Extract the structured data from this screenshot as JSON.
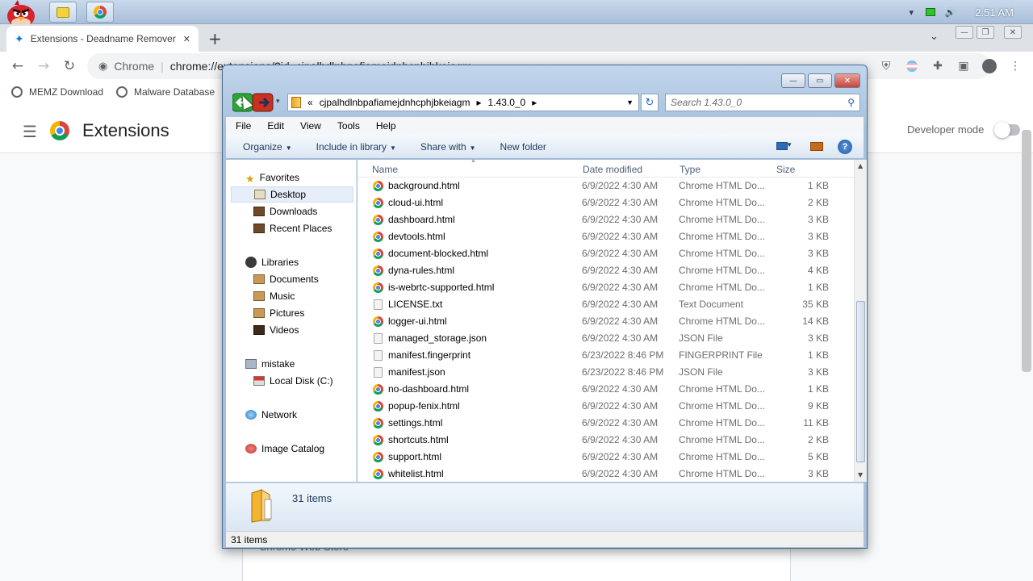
{
  "taskbar": {
    "time": "2:51 AM",
    "tray_caret": "▾",
    "icons": [
      "angry-bird-icon",
      "folder-window-icon",
      "chrome-icon",
      "battery-icon",
      "speaker-icon"
    ]
  },
  "tab": {
    "title": "Extensions - Deadname Remover",
    "close": "✕",
    "new_tab": "+"
  },
  "omnibox": {
    "site": "Chrome",
    "url": "chrome://extensions/?id=cjpalhdlnbpafiamejdnhcphjbkeiagm"
  },
  "bookmarks": [
    {
      "label": "MEMZ Download"
    },
    {
      "label": "Malware Database"
    }
  ],
  "extensions_page": {
    "title": "Extensions",
    "developer_mode": "Developer mode",
    "developer_mode_on": false,
    "webstore": "Chrome Web Store"
  },
  "explorer": {
    "breadcrumb": {
      "prefix": "«",
      "folder": "cjpalhdlnbpafiamejdnhcphjbkeiagm",
      "subfolder": "1.43.0_0",
      "sep": "▸"
    },
    "search_placeholder": "Search 1.43.0_0",
    "menu": [
      "File",
      "Edit",
      "View",
      "Tools",
      "Help"
    ],
    "commands": {
      "organize": "Organize",
      "include": "Include in library",
      "share": "Share with",
      "new_folder": "New folder"
    },
    "nav": {
      "favorites": "Favorites",
      "desktop": "Desktop",
      "downloads": "Downloads",
      "recent": "Recent Places",
      "libraries": "Libraries",
      "documents": "Documents",
      "music": "Music",
      "pictures": "Pictures",
      "videos": "Videos",
      "user": "mistake",
      "local_disk": "Local Disk (C:)",
      "network": "Network",
      "image_catalog": "Image Catalog"
    },
    "columns": {
      "name": "Name",
      "date": "Date modified",
      "type": "Type",
      "size": "Size"
    },
    "files": [
      {
        "name": "background.html",
        "date": "6/9/2022 4:30 AM",
        "type": "Chrome HTML Do...",
        "size": "1 KB",
        "icon": "chrome"
      },
      {
        "name": "cloud-ui.html",
        "date": "6/9/2022 4:30 AM",
        "type": "Chrome HTML Do...",
        "size": "2 KB",
        "icon": "chrome"
      },
      {
        "name": "dashboard.html",
        "date": "6/9/2022 4:30 AM",
        "type": "Chrome HTML Do...",
        "size": "3 KB",
        "icon": "chrome"
      },
      {
        "name": "devtools.html",
        "date": "6/9/2022 4:30 AM",
        "type": "Chrome HTML Do...",
        "size": "3 KB",
        "icon": "chrome"
      },
      {
        "name": "document-blocked.html",
        "date": "6/9/2022 4:30 AM",
        "type": "Chrome HTML Do...",
        "size": "3 KB",
        "icon": "chrome"
      },
      {
        "name": "dyna-rules.html",
        "date": "6/9/2022 4:30 AM",
        "type": "Chrome HTML Do...",
        "size": "4 KB",
        "icon": "chrome"
      },
      {
        "name": "is-webrtc-supported.html",
        "date": "6/9/2022 4:30 AM",
        "type": "Chrome HTML Do...",
        "size": "1 KB",
        "icon": "chrome"
      },
      {
        "name": "LICENSE.txt",
        "date": "6/9/2022 4:30 AM",
        "type": "Text Document",
        "size": "35 KB",
        "icon": "doc"
      },
      {
        "name": "logger-ui.html",
        "date": "6/9/2022 4:30 AM",
        "type": "Chrome HTML Do...",
        "size": "14 KB",
        "icon": "chrome"
      },
      {
        "name": "managed_storage.json",
        "date": "6/9/2022 4:30 AM",
        "type": "JSON File",
        "size": "3 KB",
        "icon": "doc"
      },
      {
        "name": "manifest.fingerprint",
        "date": "6/23/2022 8:46 PM",
        "type": "FINGERPRINT File",
        "size": "1 KB",
        "icon": "doc"
      },
      {
        "name": "manifest.json",
        "date": "6/23/2022 8:46 PM",
        "type": "JSON File",
        "size": "3 KB",
        "icon": "doc"
      },
      {
        "name": "no-dashboard.html",
        "date": "6/9/2022 4:30 AM",
        "type": "Chrome HTML Do...",
        "size": "1 KB",
        "icon": "chrome"
      },
      {
        "name": "popup-fenix.html",
        "date": "6/9/2022 4:30 AM",
        "type": "Chrome HTML Do...",
        "size": "9 KB",
        "icon": "chrome"
      },
      {
        "name": "settings.html",
        "date": "6/9/2022 4:30 AM",
        "type": "Chrome HTML Do...",
        "size": "11 KB",
        "icon": "chrome"
      },
      {
        "name": "shortcuts.html",
        "date": "6/9/2022 4:30 AM",
        "type": "Chrome HTML Do...",
        "size": "2 KB",
        "icon": "chrome"
      },
      {
        "name": "support.html",
        "date": "6/9/2022 4:30 AM",
        "type": "Chrome HTML Do...",
        "size": "5 KB",
        "icon": "chrome"
      },
      {
        "name": "whitelist.html",
        "date": "6/9/2022 4:30 AM",
        "type": "Chrome HTML Do...",
        "size": "3 KB",
        "icon": "chrome"
      }
    ],
    "details_count": "31 items",
    "status_count": "31 items"
  }
}
